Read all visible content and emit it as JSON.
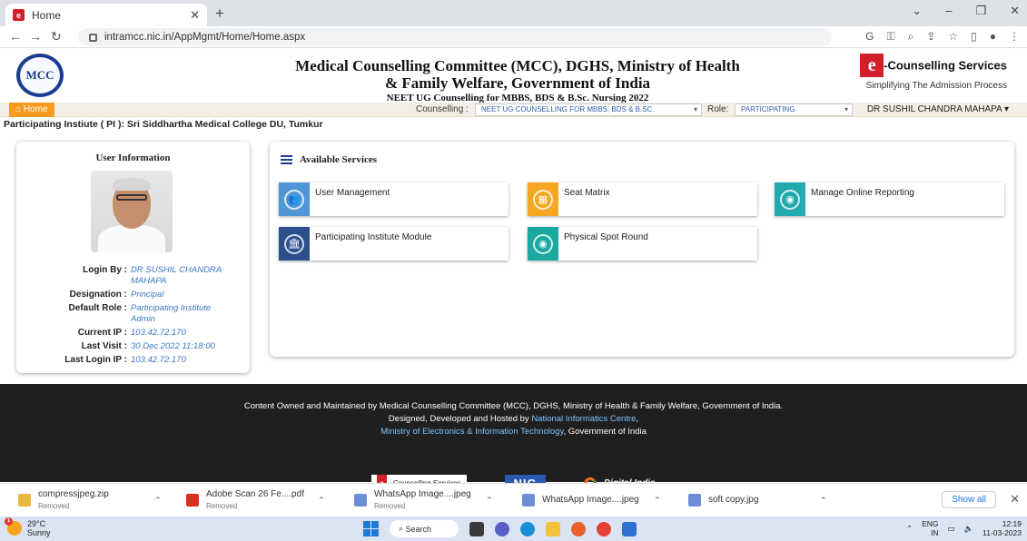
{
  "browser": {
    "tab_title": "Home",
    "url": "intramcc.nic.in/AppMgmt/Home/Home.aspx"
  },
  "header": {
    "logo_text": "MCC",
    "title_line1": "Medical Counselling Committee (MCC), DGHS, Ministry of Health",
    "title_line2": "& Family Welfare, Government of India",
    "subtitle": "NEET UG Counselling for MBBS, BDS & B.Sc. Nursing 2022",
    "brand_mark": "e",
    "brand_name": "-Counselling Services",
    "brand_tagline": "Simplifying The Admission Process"
  },
  "menubar": {
    "home": "Home",
    "counselling_label": "Counselling :",
    "counselling_value": "NEET UG COUNSELLING FOR MBBS, BDS & B.SC.",
    "role_label": "Role:",
    "role_value": "PARTICIPATING",
    "user": "DR SUSHIL CHANDRA MAHAPA"
  },
  "pi_line": "Participating Instiute ( PI ): Sri Siddhartha Medical College DU, Tumkur",
  "user_info": {
    "heading": "User Information",
    "rows": [
      {
        "k": "Login By :",
        "v": "DR SUSHIL CHANDRA MAHAPA"
      },
      {
        "k": "Designation :",
        "v": "Principal"
      },
      {
        "k": "Default Role :",
        "v": "Participating Institute Admin"
      },
      {
        "k": "Current IP :",
        "v": "103.42.72.170"
      },
      {
        "k": "Last Visit :",
        "v": "30 Dec 2022 11:18:00"
      },
      {
        "k": "Last Login IP :",
        "v": "103.42.72.170"
      }
    ]
  },
  "services": {
    "heading": "Available Services",
    "items": [
      {
        "label": "User Management",
        "color": "#4f96d6"
      },
      {
        "label": "Seat Matrix",
        "color": "#f5a623"
      },
      {
        "label": "Manage Online Reporting",
        "color": "#20aab0"
      },
      {
        "label": "Participating Institute Module",
        "color": "#2b4f8c"
      },
      {
        "label": "Physical Spot Round",
        "color": "#1ba8a0"
      }
    ]
  },
  "footer": {
    "line1": "Content Owned and Maintained by Medical Counselling Committee (MCC), DGHS, Ministry of Health & Family Welfare, Government of India.",
    "line2_pre": "Designed, Developed and Hosted by ",
    "line2_link": "National Informatics Centre",
    "line2_post": ",",
    "line3_link": "Ministry of Electronics & Information Technology",
    "line3_post": ", Government of India",
    "logo1": "Counselling Services",
    "logo2": "NIC",
    "logo3": "Digital India"
  },
  "downloads": {
    "items": [
      {
        "name": "compressjpeg.zip",
        "status": "Removed"
      },
      {
        "name": "Adobe Scan 26 Fe....pdf",
        "status": "Removed"
      },
      {
        "name": "WhatsApp Image....jpeg",
        "status": "Removed"
      },
      {
        "name": "WhatsApp Image....jpeg",
        "status": ""
      },
      {
        "name": "soft copy.jpg",
        "status": ""
      }
    ],
    "show_all": "Show all"
  },
  "taskbar": {
    "temp": "29°C",
    "weather": "Sunny",
    "search": "Search",
    "lang1": "ENG",
    "lang2": "IN",
    "time": "12:19",
    "date": "11-03-2023",
    "badge": "1"
  }
}
